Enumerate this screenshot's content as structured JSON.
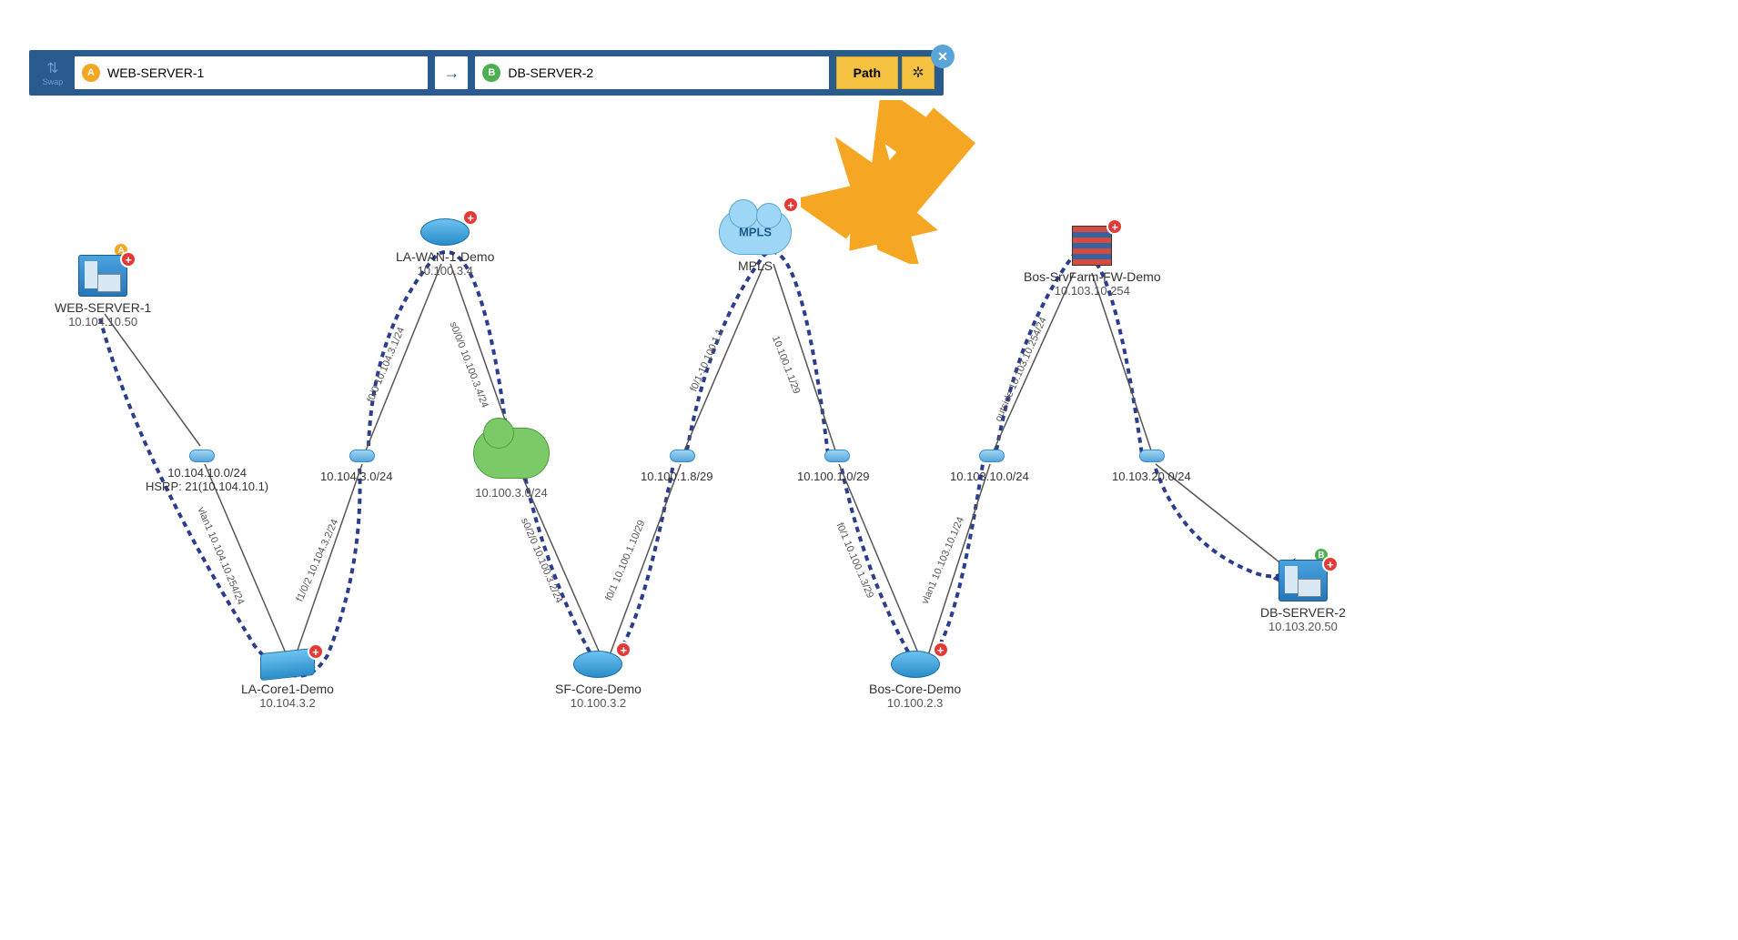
{
  "toolbar": {
    "swap_label": "Swap",
    "source_value": "WEB-SERVER-1",
    "dest_value": "DB-SERVER-2",
    "path_label": "Path"
  },
  "nodes": {
    "web_server": {
      "name": "WEB-SERVER-1",
      "ip": "10.104.10.50",
      "badge": "A"
    },
    "la_core": {
      "name": "LA-Core1-Demo",
      "ip": "10.104.3.2"
    },
    "la_wan": {
      "name": "LA-WAN-1-Demo",
      "ip": "10.100.3.4"
    },
    "sf_core": {
      "name": "SF-Core-Demo",
      "ip": "10.100.3.2"
    },
    "mpls": {
      "name": "MPLS"
    },
    "bos_core": {
      "name": "Bos-Core-Demo",
      "ip": "10.100.2.3"
    },
    "bos_fw": {
      "name": "Bos-SrvFarm-FW-Demo",
      "ip": "10.103.10.254"
    },
    "db_server": {
      "name": "DB-SERVER-2",
      "ip": "10.103.20.50",
      "badge": "B"
    }
  },
  "subnets": {
    "s1": {
      "cidr": "10.104.10.0/24",
      "extra": "HSRP: 21(10.104.10.1)"
    },
    "s2": {
      "cidr": "10.104.3.0/24"
    },
    "s3": {
      "cidr": "10.100.3.0/24"
    },
    "s4": {
      "cidr": "10.100.1.8/29"
    },
    "s5": {
      "cidr": "10.100.1.0/29"
    },
    "s6": {
      "cidr": "10.103.10.0/24"
    },
    "s7": {
      "cidr": "10.103.20.0/24"
    }
  },
  "link_labels": {
    "l1": "vlan1 10.104.10.254/24",
    "l2": "f1/0/2 10.104.3.2/24",
    "l3": "f0/0 10.104.3.1/24",
    "l4": "s0/0/0 10.100.3.4/24",
    "l5": "s0/2/0 10.100.3.2/24",
    "l6": "f0/1 10.100.1.10/29",
    "l7": "f0/1-10.100.1.1",
    "l8": "10.100.1.1/29",
    "l9": "f0/1 10.100.1.3/29",
    "l10": "vlan1 10.103.10.1/24",
    "l11": "outside 10.103.10.254/24"
  },
  "colors": {
    "toolbar_bg": "#2a5b8e",
    "path_btn": "#f5c242",
    "arrow_annotation": "#f5a623",
    "path_line": "#2a3d8e",
    "badge_a": "#f5a623",
    "badge_b": "#4caf50",
    "plus": "#e53935"
  }
}
